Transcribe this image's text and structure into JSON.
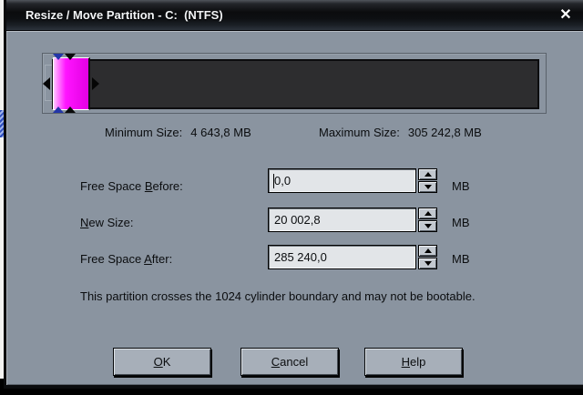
{
  "window": {
    "title": "Resize / Move Partition - C:  (NTFS)",
    "close_glyph": "✕"
  },
  "colors": {
    "client_background": "#8a94a0",
    "partition_fill": "#ff00ff",
    "disk_bar_fill": "#2d2d2f",
    "handle_blue": "#2336a8",
    "titlebar_dark": "#0b0c0e"
  },
  "size_info": {
    "min_label": "Minimum Size:",
    "min_value": "4 643,8 MB",
    "max_label": "Maximum Size:",
    "max_value": "305 242,8 MB"
  },
  "fields": [
    {
      "label_pre": "Free Space ",
      "label_accel": "B",
      "label_post": "efore:",
      "value": "0,0",
      "unit": "MB"
    },
    {
      "label_pre": "",
      "label_accel": "N",
      "label_post": "ew Size:",
      "value": "20 002,8",
      "unit": "MB"
    },
    {
      "label_pre": "Free Space ",
      "label_accel": "A",
      "label_post": "fter:",
      "value": "285 240,0",
      "unit": "MB"
    }
  ],
  "warning": "This partition crosses the 1024 cylinder boundary and may not be bootable.",
  "buttons": [
    {
      "accel": "O",
      "rest": "K"
    },
    {
      "accel": "C",
      "rest": "ancel"
    },
    {
      "accel": "H",
      "rest": "elp"
    }
  ]
}
